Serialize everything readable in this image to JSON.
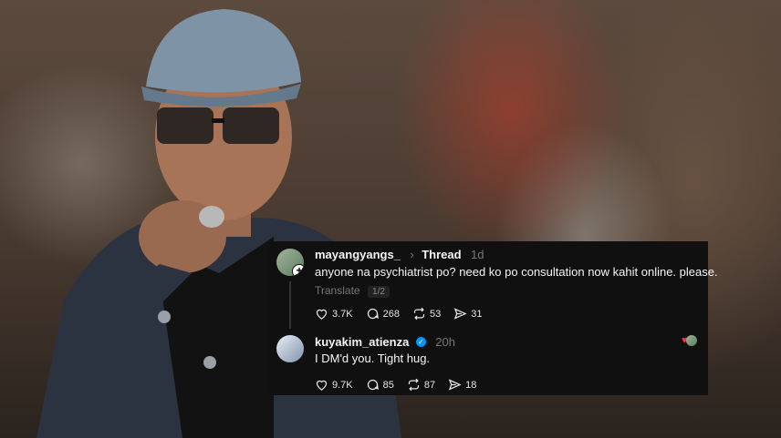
{
  "post": {
    "username": "mayangyangs_",
    "breadcrumb_sep": "›",
    "thread_label": "Thread",
    "time": "1d",
    "text": "anyone na psychiatrist po? need ko po consultation now kahit online. please.",
    "translate": "Translate",
    "page_indicator": "1/2",
    "likes": "3.7K",
    "replies": "268",
    "reposts": "53",
    "shares": "31"
  },
  "reply": {
    "username": "kuyakim_atienza",
    "time": "20h",
    "text": "I DM'd you. Tight hug.",
    "likes": "9.7K",
    "replies": "85",
    "reposts": "87",
    "shares": "18"
  },
  "icons": [
    "heart-icon",
    "comment-icon",
    "repost-icon",
    "share-icon",
    "verified-icon",
    "follow-plus-icon"
  ],
  "colors": {
    "card_bg": "#101010",
    "text": "#f3f5f7",
    "muted": "#777777",
    "verified": "#0095f6",
    "liked_heart": "#ff3040"
  }
}
